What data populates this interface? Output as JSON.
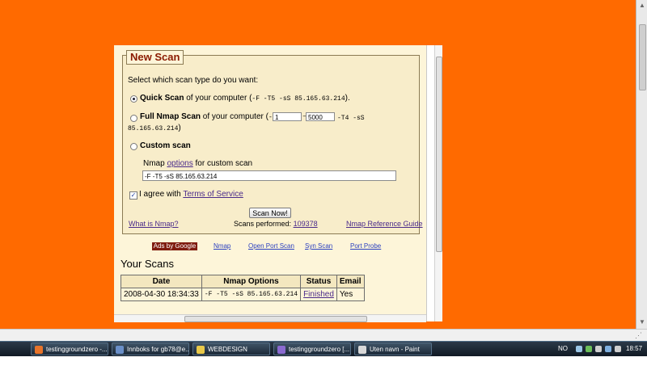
{
  "form": {
    "legend": "New Scan",
    "prompt": "Select which scan type do you want:",
    "quick": {
      "label": "Quick Scan",
      "suffix_before": "of your computer (",
      "command": "-F -T5 -sS 85.165.63.214",
      "suffix_after": ")."
    },
    "full": {
      "label": "Full Nmap Scan",
      "text": "of your computer (",
      "p_flag": "-p",
      "port_from": "1",
      "dash": "–",
      "port_to": "5000",
      "cmd_tail": "-T4 -sS",
      "target": "85.165.63.214",
      "close": ")"
    },
    "custom": {
      "label": "Custom scan",
      "options_prefix": "Nmap",
      "options_link": "options",
      "options_suffix": "for custom scan",
      "command_value": "-F -T5 -sS 85.165.63.214"
    },
    "agree_prefix": "I agree with",
    "agree_link": "Terms of Service",
    "agree_checked": true,
    "scan_button": "Scan Now!",
    "what_is_nmap": "What is Nmap?",
    "scans_performed_label": "Scans performed:",
    "scans_performed_value": "109378",
    "reference_guide": "Nmap Reference Guide"
  },
  "ads": {
    "label": "Ads by Google",
    "links": [
      "Nmap",
      "Open Port Scan",
      "Syn Scan",
      "Port Probe"
    ]
  },
  "your_scans": {
    "title": "Your Scans",
    "columns": [
      "Date",
      "Nmap Options",
      "Status",
      "Email"
    ],
    "rows": [
      {
        "date": "2008-04-30 18:34:33",
        "options": "-F -T5 -sS 85.165.63.214",
        "status": "Finished",
        "email": "Yes"
      }
    ]
  },
  "taskbar": {
    "buttons": [
      {
        "label": "testinggroundzero -...",
        "color": "#e8742a"
      },
      {
        "label": "Innboks for gb78@e...",
        "color": "#6a8fc8"
      },
      {
        "label": "WEBDESIGN",
        "color": "#e8c84a"
      },
      {
        "label": "testinggroundzero [...",
        "color": "#8a6ad0"
      },
      {
        "label": "Uten navn - Paint",
        "color": "#d8d8d8"
      }
    ],
    "lang": "NO",
    "clock": "18:57"
  }
}
